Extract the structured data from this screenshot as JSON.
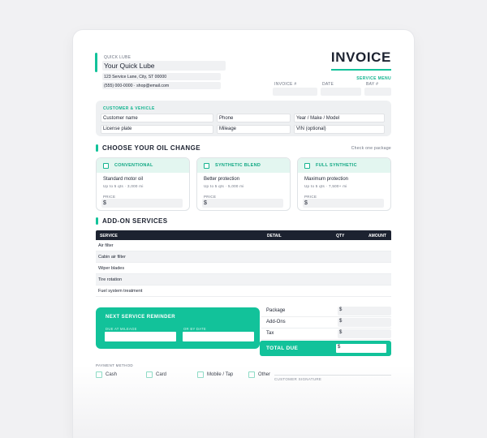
{
  "shop": {
    "label": "QUICK LUBE",
    "name": "Your Quick Lube",
    "address": "123 Service Lane, City, ST 00000",
    "contact": "(555) 000-0000 · shop@email.com"
  },
  "invoice": {
    "title": "INVOICE",
    "subtitle": "SERVICE MENU",
    "fields": [
      "INVOICE #",
      "DATE",
      "BAY #"
    ]
  },
  "customer": {
    "title": "CUSTOMER & VEHICLE",
    "fields": [
      "Customer name",
      "Phone",
      "Year / Make / Model",
      "License plate",
      "Mileage",
      "VIN (optional)"
    ]
  },
  "oil": {
    "title": "CHOOSE YOUR OIL CHANGE",
    "hint": "Check one package",
    "options": [
      {
        "name": "CONVENTIONAL",
        "desc": "Standard motor oil",
        "sub": "Up to 5 qts · 3,000 mi",
        "price_label": "PRICE",
        "currency": "$"
      },
      {
        "name": "SYNTHETIC BLEND",
        "desc": "Better protection",
        "sub": "Up to 5 qts · 5,000 mi",
        "price_label": "PRICE",
        "currency": "$"
      },
      {
        "name": "FULL SYNTHETIC",
        "desc": "Maximum protection",
        "sub": "Up to 5 qts · 7,500+ mi",
        "price_label": "PRICE",
        "currency": "$"
      }
    ]
  },
  "addons": {
    "title": "ADD-ON SERVICES",
    "columns": [
      "SERVICE",
      "DETAIL",
      "QTY",
      "AMOUNT"
    ],
    "rows": [
      "Air filter",
      "Cabin air filter",
      "Wiper blades",
      "Tire rotation",
      "Fuel system treatment"
    ]
  },
  "reminder": {
    "title": "NEXT SERVICE REMINDER",
    "mileage_label": "DUE AT MILEAGE",
    "date_label": "OR BY DATE"
  },
  "totals": {
    "rows": [
      {
        "label": "Package",
        "currency": "$"
      },
      {
        "label": "Add-Ons",
        "currency": "$"
      },
      {
        "label": "Tax",
        "currency": "$"
      }
    ],
    "total_label": "TOTAL DUE",
    "total_currency": "$"
  },
  "payment": {
    "label": "PAYMENT METHOD",
    "methods": [
      "Cash",
      "Card",
      "Mobile / Tap",
      "Other"
    ]
  },
  "signature": {
    "label": "CUSTOMER SIGNATURE"
  },
  "colors": {
    "accent": "#12c29a",
    "dark": "#1c2230",
    "tint": "#e3f6f0"
  }
}
